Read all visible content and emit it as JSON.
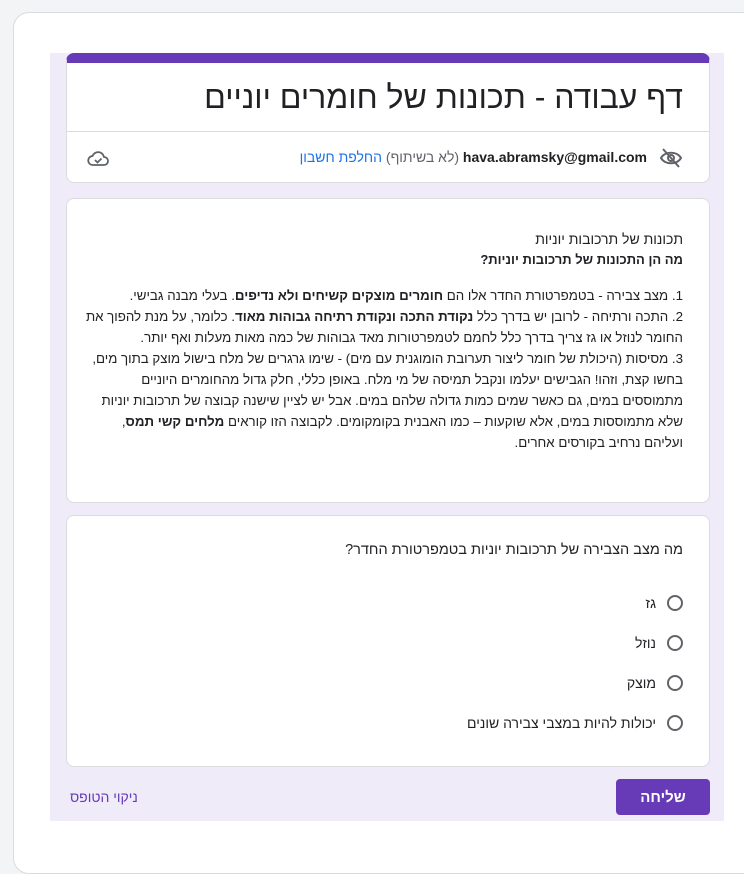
{
  "form": {
    "title": "דף עבודה - תכונות של חומרים יוניים",
    "accent_color": "#673ab7"
  },
  "account": {
    "email": "hava.abramsky@gmail.com",
    "sharing_note": " (לא בשיתוף) ",
    "switch_label": "החלפת חשבון",
    "hidden_icon": "eye-off-icon",
    "draft_icon": "cloud-check-icon"
  },
  "section": {
    "title": "תכונות של תרכובות יוניות",
    "question": "מה הן התכונות של תרכובות יוניות?",
    "items": [
      {
        "parts": [
          {
            "text": "1. מצב צבירה - בטמפרטורת החדר אלו הם ",
            "bold": false
          },
          {
            "text": "חומרים מוצקים קשיחים ולא נדיפים",
            "bold": true
          },
          {
            "text": ". בעלי מבנה גבישי.",
            "bold": false
          }
        ]
      },
      {
        "parts": [
          {
            "text": "2. התכה ורתיחה - לרובן יש בדרך כלל ",
            "bold": false
          },
          {
            "text": "נקודת התכה ונקודת רתיחה גבוהות מאוד",
            "bold": true
          },
          {
            "text": ". כלומר, על מנת להפוך את החומר לנוזל או גז צריך בדרך כלל לחמם לטמפרטורות מאד גבוהות של כמה מאות מעלות ואף יותר.",
            "bold": false
          }
        ]
      },
      {
        "parts": [
          {
            "text": "3. מסיסות (היכולת של חומר ליצור תערובת הומוגנית עם מים) - שימו גרגרים של מלח בישול מוצק בתוך מים, בחשו קצת, וזהו! הגבישים יעלמו ונקבל תמיסה של מי מלח. באופן כללי, חלק גדול מהחומרים היוניים מתמוססים במים, גם כאשר שמים כמות גדולה שלהם במים. אבל יש לציין שישנה קבוצה של תרכובות יוניות שלא מתמוססות במים, אלא שוקעות – כמו האבנית בקומקומים. לקבוצה הזו קוראים ",
            "bold": false
          },
          {
            "text": "מלחים קשי תמס",
            "bold": true
          },
          {
            "text": ", ועליהם נרחיב בקורסים אחרים.",
            "bold": false
          }
        ]
      }
    ]
  },
  "question": {
    "text": "מה מצב הצבירה של תרכובות יוניות בטמפרטורת החדר?",
    "options": [
      "גז",
      "נוזל",
      "מוצק",
      "יכולות להיות במצבי צבירה שונים"
    ]
  },
  "actions": {
    "submit_label": "שליחה",
    "clear_label": "ניקוי הטופס"
  }
}
